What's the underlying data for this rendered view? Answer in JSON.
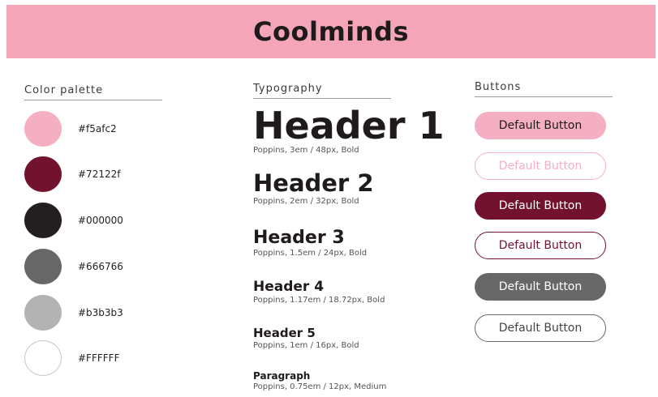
{
  "header": {
    "title": "Coolminds"
  },
  "sections": {
    "palette_title": "Color palette",
    "typography_title": "Typography",
    "buttons_title": "Buttons"
  },
  "palette": [
    {
      "hex": "#f5afc2",
      "color": "#f5afc2"
    },
    {
      "hex": "#72122f",
      "color": "#72122f"
    },
    {
      "hex": "#000000",
      "color": "#231f20"
    },
    {
      "hex": "#666766",
      "color": "#666766"
    },
    {
      "hex": "#b3b3b3",
      "color": "#b3b3b3"
    },
    {
      "hex": "#FFFFFF",
      "color": "#ffffff"
    }
  ],
  "typography": [
    {
      "name": "Header 1",
      "spec": "Poppins, 3em / 48px, Bold"
    },
    {
      "name": "Header 2",
      "spec": "Poppins, 2em / 32px, Bold"
    },
    {
      "name": "Header 3",
      "spec": "Poppins, 1.5em / 24px, Bold"
    },
    {
      "name": "Header 4",
      "spec": "Poppins, 1.17em / 18.72px, Bold"
    },
    {
      "name": "Header 5",
      "spec": "Poppins, 1em / 16px, Bold"
    },
    {
      "name": "Paragraph",
      "spec": "Poppins, 0.75em / 12px, Medium"
    }
  ],
  "buttons": [
    {
      "label": "Default Button"
    },
    {
      "label": "Default Button"
    },
    {
      "label": "Default Button"
    },
    {
      "label": "Default Button"
    },
    {
      "label": "Default Button"
    },
    {
      "label": "Default Button"
    }
  ]
}
